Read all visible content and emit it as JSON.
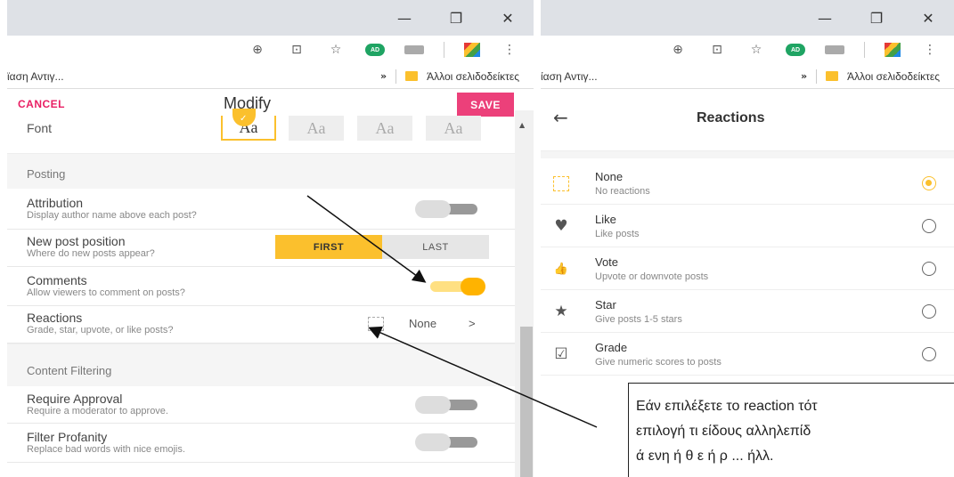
{
  "browser_left": {
    "window": {
      "minimize": "—",
      "restore": "❐",
      "close": "✕"
    },
    "bookmarks": {
      "left_text": "ϊαση Αντιγ...",
      "more": "»",
      "folder_label": "Άλλοι σελιδοδείκτες"
    }
  },
  "browser_right": {
    "window": {
      "minimize": "—",
      "restore": "❐",
      "close": "✕"
    },
    "bookmarks": {
      "left_text": "ίαση Αντιγ...",
      "more": "»",
      "folder_label": "Άλλοι σελιδοδείκτες"
    }
  },
  "toolbar_icons": {
    "add": "⊕",
    "translate": "⊡",
    "star": "☆",
    "profile": "AD",
    "menu": "⋮"
  },
  "modify": {
    "cancel": "CANCEL",
    "title": "Modify",
    "save": "SAVE",
    "font": {
      "label": "Font",
      "options": [
        "Aa",
        "Aa",
        "Aa",
        "Aa"
      ],
      "selected_index": 0
    },
    "posting": {
      "title": "Posting",
      "attribution": {
        "title": "Attribution",
        "subtitle": "Display author name above each post?",
        "enabled": false
      },
      "new_post_position": {
        "title": "New post position",
        "subtitle": "Where do new posts appear?",
        "first": "FIRST",
        "last": "LAST",
        "selected": "FIRST"
      },
      "comments": {
        "title": "Comments",
        "subtitle": "Allow viewers to comment on posts?",
        "enabled": true
      },
      "reactions": {
        "title": "Reactions",
        "subtitle": "Grade, star, upvote, or like posts?",
        "value": "None",
        "chevron": ">"
      }
    },
    "content_filtering": {
      "title": "Content Filtering",
      "require_approval": {
        "title": "Require Approval",
        "subtitle": "Require a moderator to approve.",
        "enabled": false
      },
      "filter_profanity": {
        "title": "Filter Profanity",
        "subtitle": "Replace bad words with nice emojis.",
        "enabled": false
      }
    }
  },
  "reactions": {
    "back": "←",
    "title": "Reactions",
    "options": [
      {
        "name": "None",
        "desc": "No reactions",
        "icon": "dashed-square-icon",
        "selected": true
      },
      {
        "name": "Like",
        "desc": "Like posts",
        "icon": "heart-icon",
        "glyph": "♥",
        "selected": false
      },
      {
        "name": "Vote",
        "desc": "Upvote or downvote posts",
        "icon": "thumbs-icon",
        "glyph": "👍",
        "selected": false
      },
      {
        "name": "Star",
        "desc": "Give posts 1-5 stars",
        "icon": "star-icon",
        "glyph": "★",
        "selected": false
      },
      {
        "name": "Grade",
        "desc": "Give numeric scores to posts",
        "icon": "check-box-icon",
        "glyph": "☑",
        "selected": false
      }
    ]
  },
  "annotation": {
    "line1": "Εάν επιλέξετε το reaction τότ",
    "line2": "επιλογή τι είδους αλληλεπίδ",
    "line3": "ά ενη ή θ ε ή ρ ... ήλλ."
  }
}
